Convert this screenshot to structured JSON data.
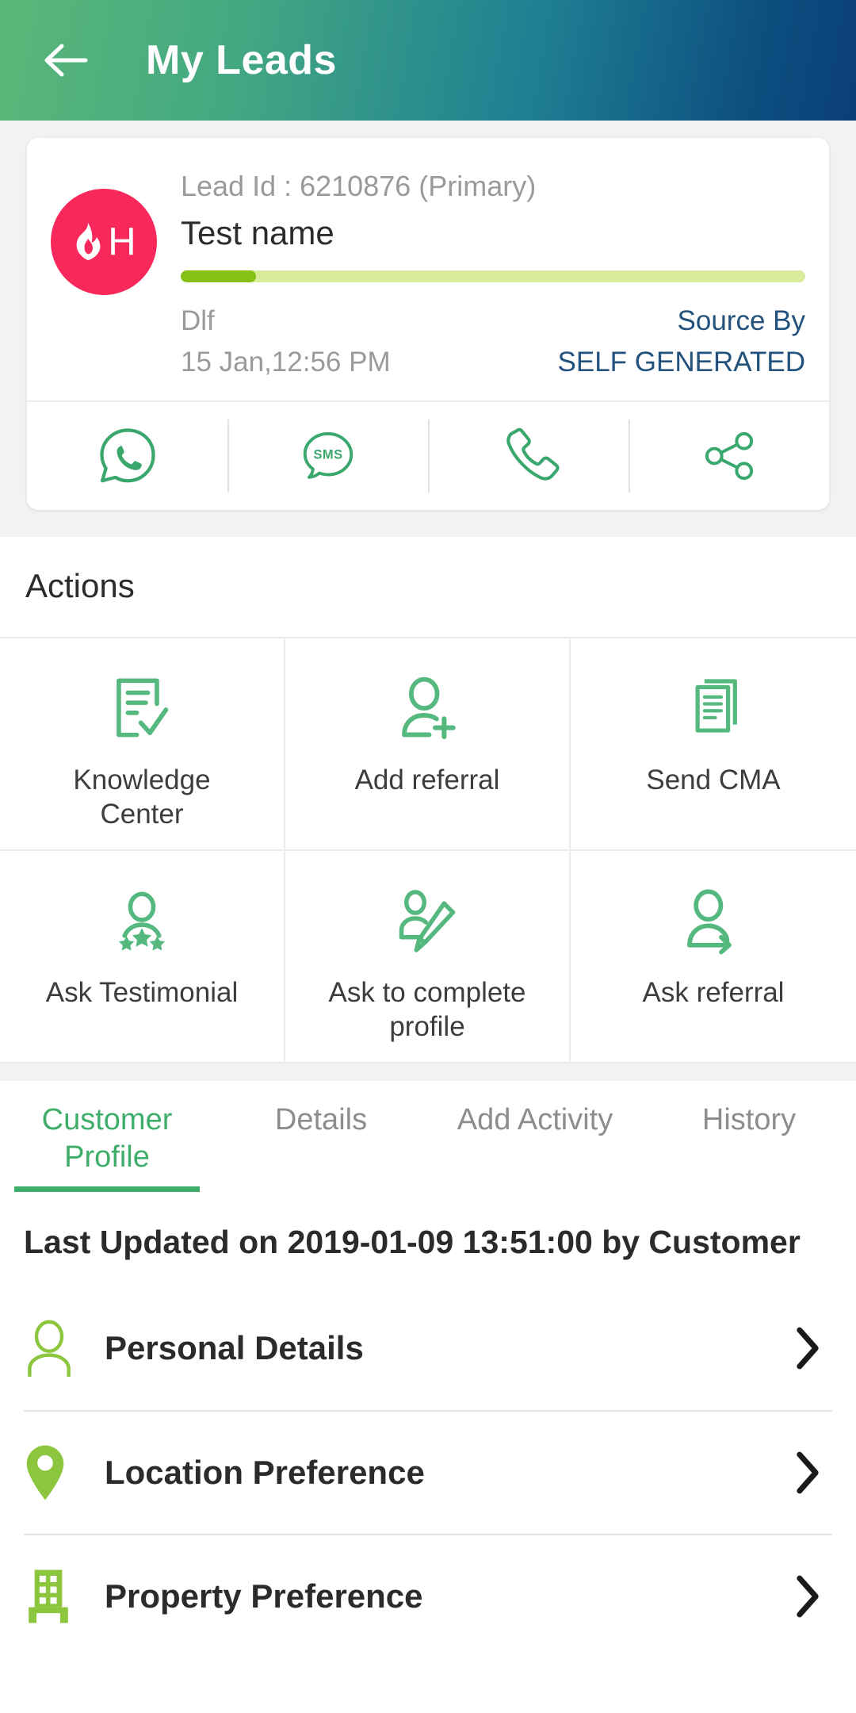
{
  "appbar": {
    "title": "My Leads",
    "back_icon": "arrow-left-icon"
  },
  "lead_card": {
    "avatar": {
      "grade_letter": "H",
      "icon": "flame-icon",
      "bg_color": "#f8295a"
    },
    "lead_id_text": "Lead Id : 6210876 (Primary)",
    "name": "Test name",
    "progress_percent": 12,
    "progress_fill_color": "#86c017",
    "progress_track_color": "#d7eb9a",
    "project": "Dlf",
    "datetime": "15 Jan,12:56 PM",
    "source_label": "Source By",
    "source_value": "SELF GENERATED",
    "source_color": "#23527c",
    "contact_actions": [
      {
        "name": "whatsapp-icon",
        "label": "WhatsApp"
      },
      {
        "name": "sms-icon",
        "label": "SMS"
      },
      {
        "name": "call-icon",
        "label": "Call"
      },
      {
        "name": "share-icon",
        "label": "Share"
      }
    ]
  },
  "actions": {
    "heading": "Actions",
    "accent_color": "#55b97f",
    "items": [
      {
        "label": "Knowledge Center",
        "icon": "document-check-icon"
      },
      {
        "label": "Add referral",
        "icon": "person-add-icon"
      },
      {
        "label": "Send CMA",
        "icon": "documents-stack-icon"
      },
      {
        "label": "Ask Testimonial",
        "icon": "person-stars-icon"
      },
      {
        "label": "Ask to complete profile",
        "icon": "person-pencil-icon"
      },
      {
        "label": "Ask referral",
        "icon": "person-arrow-icon"
      }
    ]
  },
  "tabs": {
    "active_color": "#3fae6a",
    "items": [
      {
        "label": "Customer Profile",
        "active": true
      },
      {
        "label": "Details",
        "active": false
      },
      {
        "label": "Add Activity",
        "active": false
      },
      {
        "label": "History",
        "active": false
      }
    ]
  },
  "customer_profile": {
    "last_updated": "Last Updated on 2019-01-09 13:51:00 by Customer",
    "icon_color": "#8cc63e",
    "rows": [
      {
        "label": "Personal Details",
        "icon": "person-outline-icon",
        "chevron": "chevron-right-icon"
      },
      {
        "label": "Location Preference",
        "icon": "map-pin-icon",
        "chevron": "chevron-right-icon"
      },
      {
        "label": "Property Preference",
        "icon": "building-icon",
        "chevron": "chevron-right-icon"
      }
    ]
  }
}
